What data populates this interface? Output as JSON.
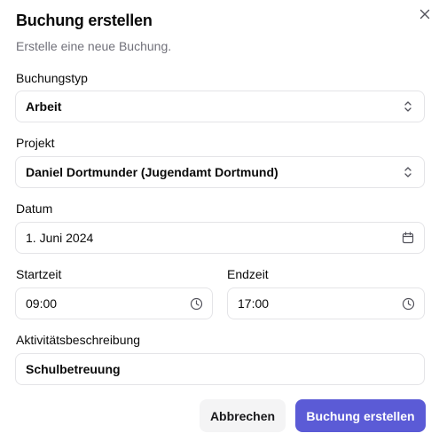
{
  "dialog": {
    "title": "Buchung erstellen",
    "subtitle": "Erstelle eine neue Buchung."
  },
  "fields": {
    "booking_type": {
      "label": "Buchungstyp",
      "value": "Arbeit"
    },
    "project": {
      "label": "Projekt",
      "value": "Daniel Dortmunder (Jugendamt Dortmund)"
    },
    "date": {
      "label": "Datum",
      "value": "1. Juni 2024"
    },
    "start_time": {
      "label": "Startzeit",
      "value": "09:00"
    },
    "end_time": {
      "label": "Endzeit",
      "value": "17:00"
    },
    "activity": {
      "label": "Aktivitätsbeschreibung",
      "value": "Schulbetreuung"
    }
  },
  "actions": {
    "cancel_label": "Abbrechen",
    "submit_label": "Buchung erstellen"
  },
  "icons": {
    "close": "close-icon",
    "select": "chevrons-up-down-icon",
    "date": "calendar-icon",
    "time": "clock-icon"
  },
  "colors": {
    "primary": "#5b5bd6",
    "muted_text": "#71717a",
    "border": "#e4e4e7",
    "secondary_bg": "#f4f4f5"
  }
}
